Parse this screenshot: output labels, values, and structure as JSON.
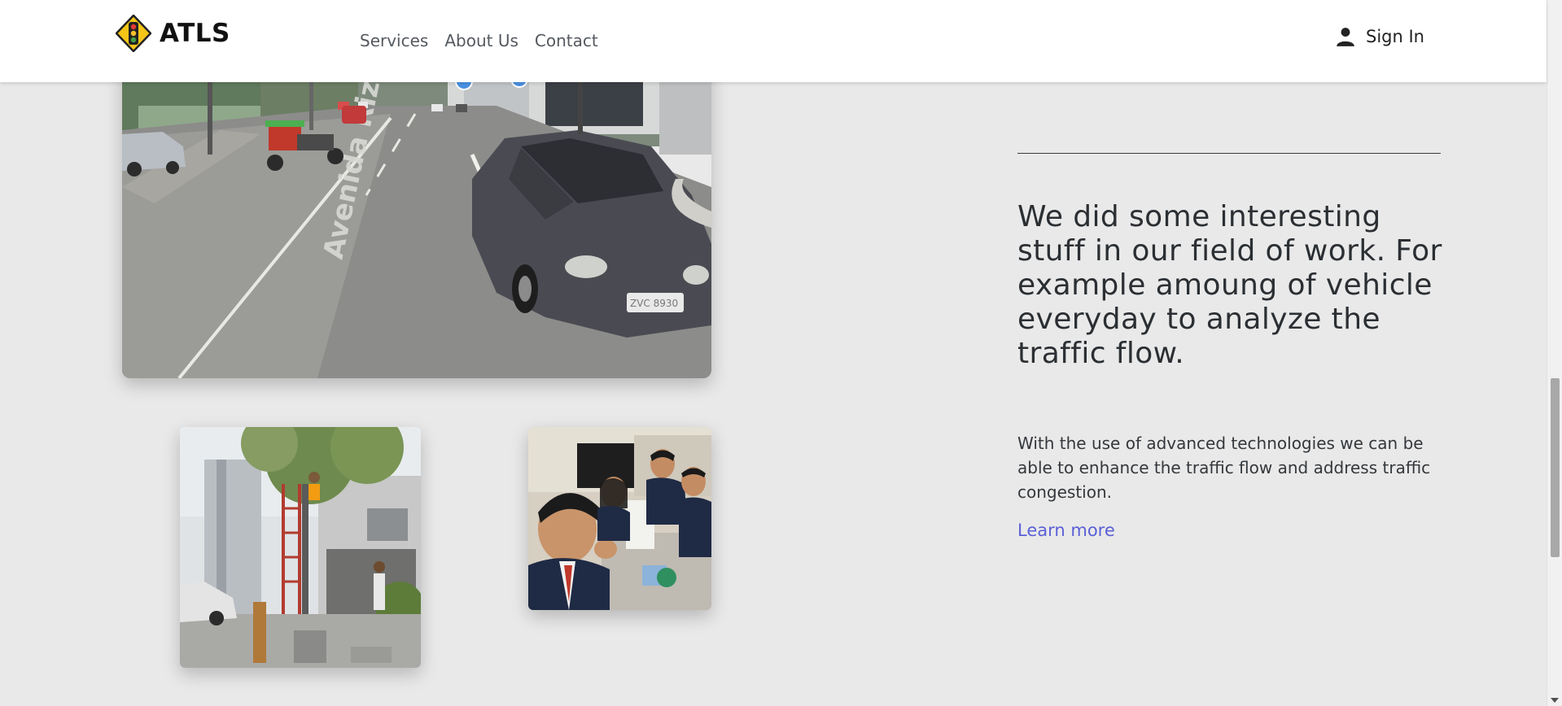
{
  "header": {
    "brand_name": "ATLS",
    "logo_icon": "traffic-light-icon",
    "nav": [
      {
        "label": "Services"
      },
      {
        "label": "About Us"
      },
      {
        "label": "Contact"
      }
    ],
    "signin_label": "Sign In",
    "signin_icon": "user-icon"
  },
  "images": {
    "street": {
      "street_sign": "Avenida Rizal",
      "plate": "ZVC 8930"
    },
    "worker": {},
    "team": {}
  },
  "content": {
    "headline": "We did some interesting stuff in our field of work. For example amoung of vehicle everyday to analyze the traffic flow.",
    "body": "With the use of advanced technologies we can be able to enhance the traffic flow and address traffic congestion.",
    "link_label": "Learn more"
  },
  "colors": {
    "page_bg": "#e9e9e9",
    "header_bg": "#ffffff",
    "link": "#5b5fd6",
    "logo_yellow": "#f5c518"
  }
}
